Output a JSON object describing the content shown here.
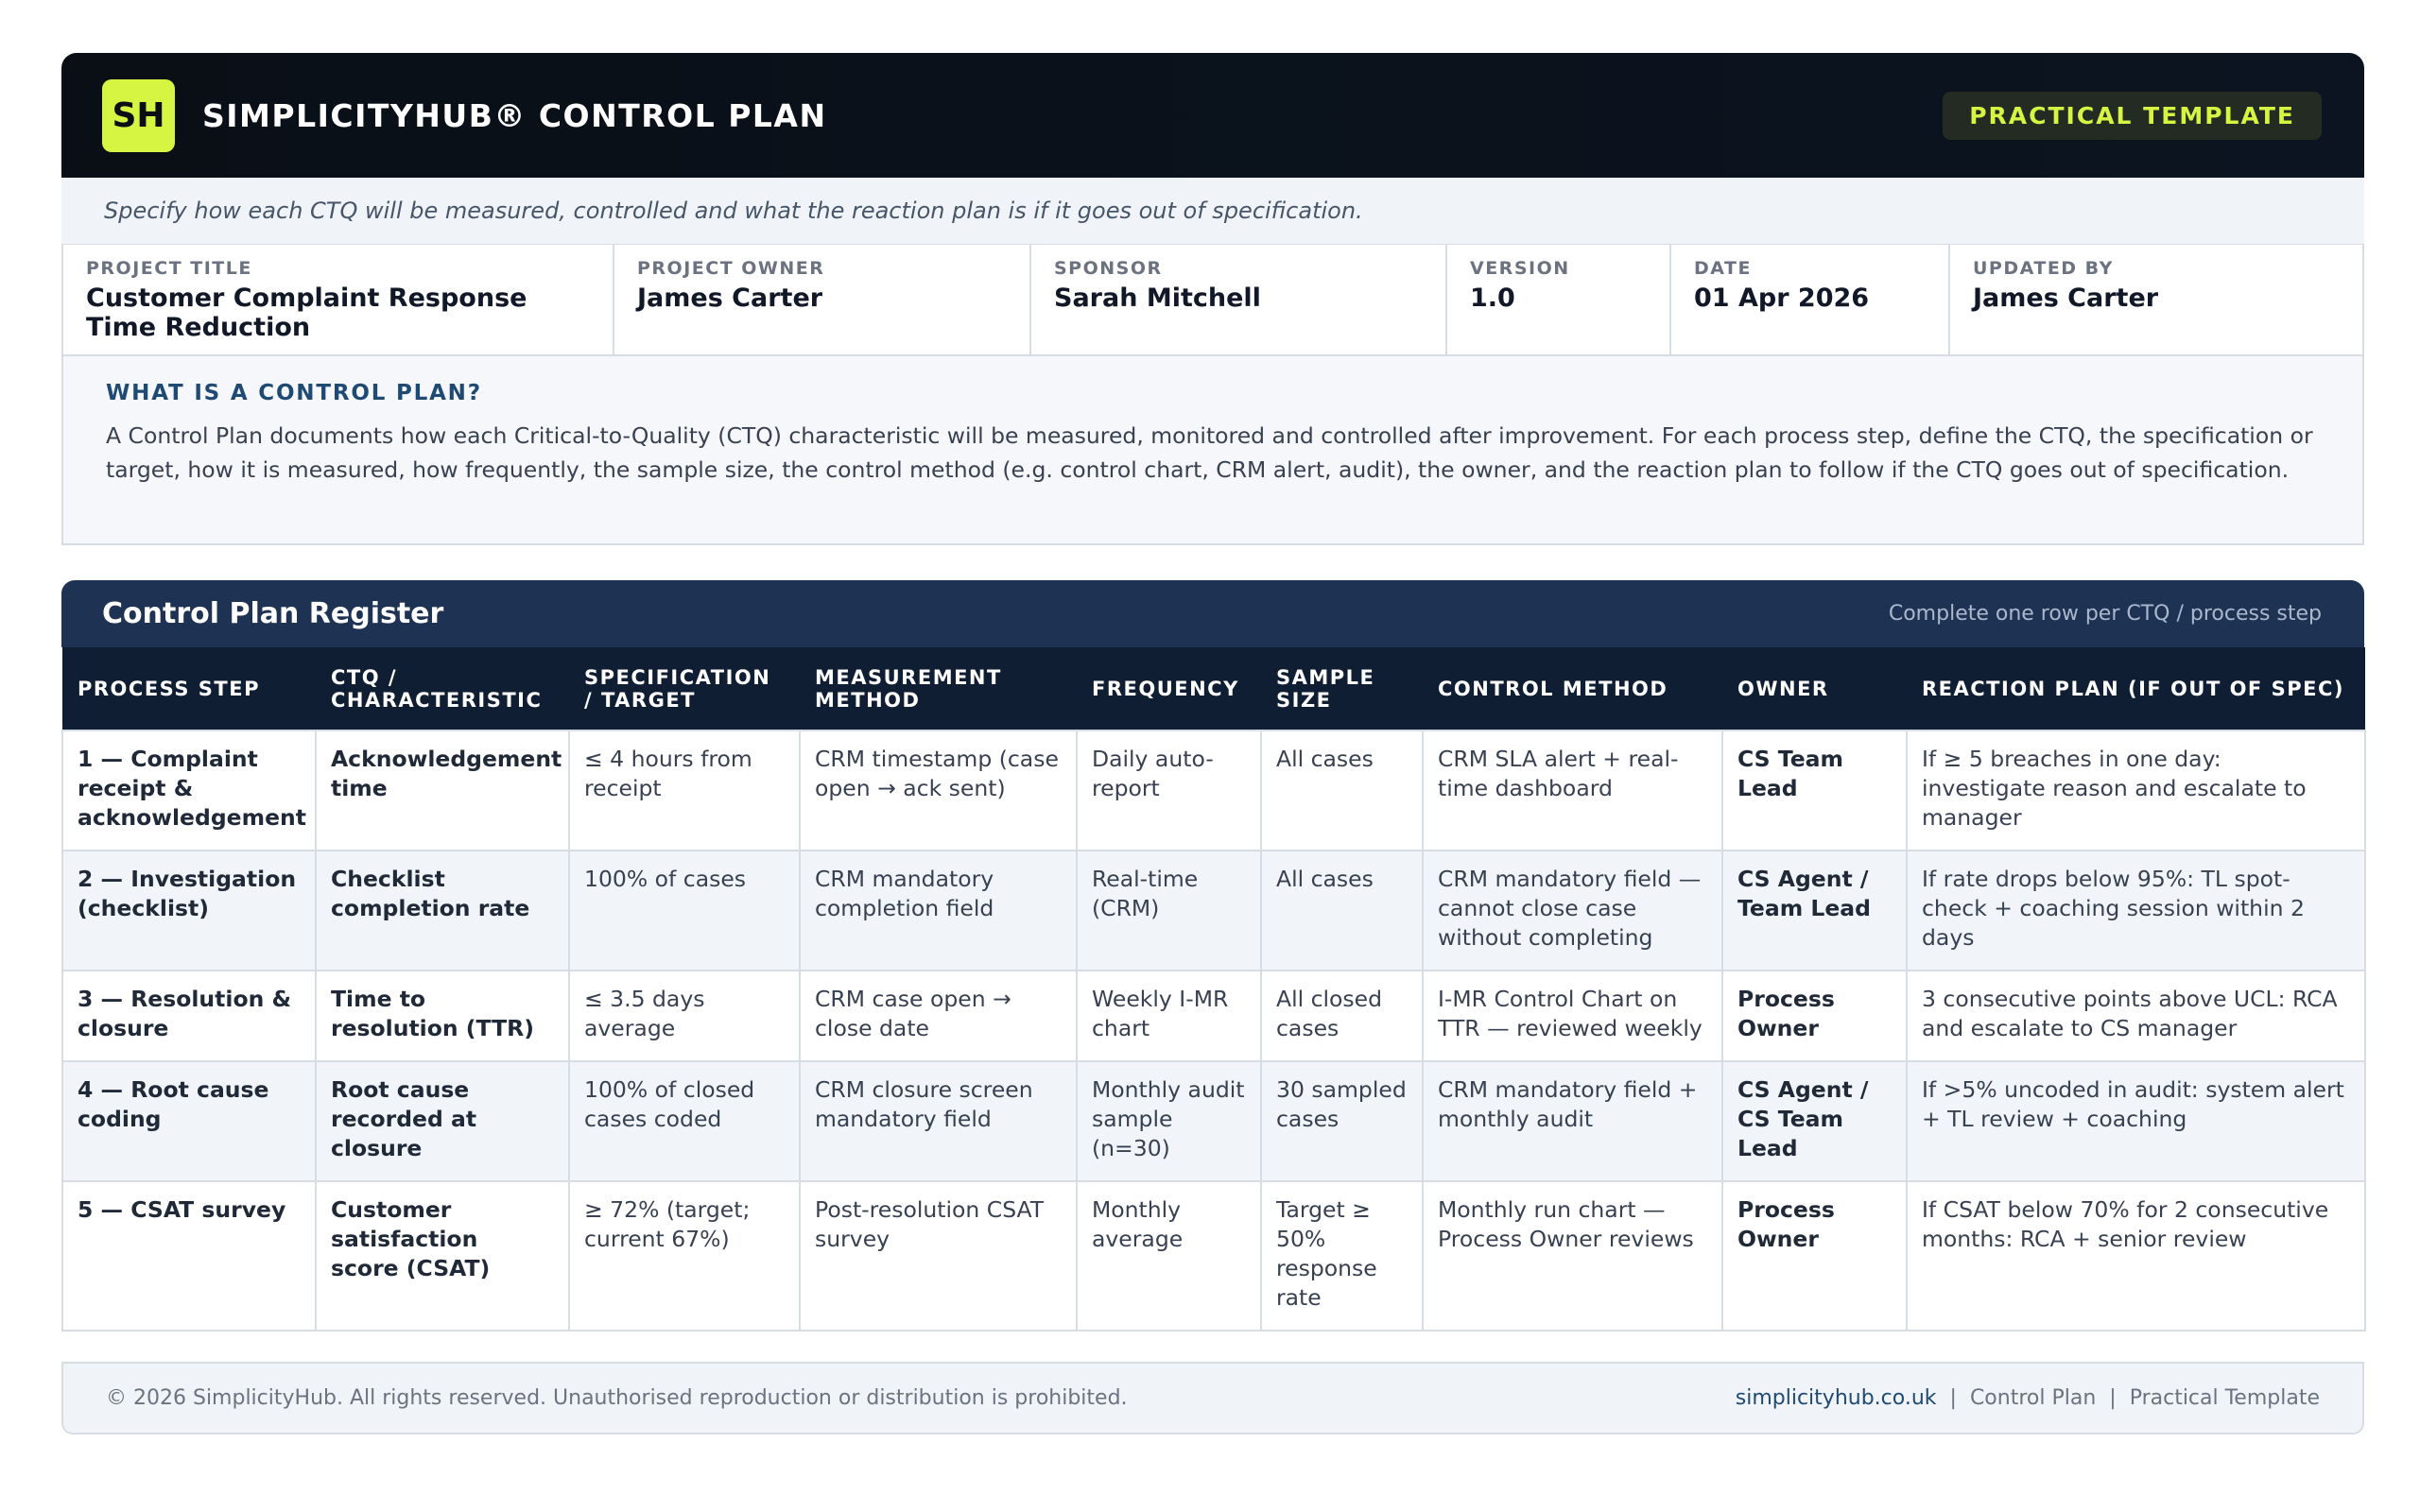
{
  "header": {
    "logo": "SH",
    "title": "SIMPLICITYHUB® CONTROL PLAN",
    "badge": "PRACTICAL TEMPLATE"
  },
  "intro": "Specify how each CTQ will be measured, controlled and what the reaction plan is if it goes out of specification.",
  "meta": [
    {
      "label": "PROJECT TITLE",
      "value": "Customer Complaint Response Time Reduction"
    },
    {
      "label": "PROJECT OWNER",
      "value": "James Carter"
    },
    {
      "label": "SPONSOR",
      "value": "Sarah Mitchell"
    },
    {
      "label": "VERSION",
      "value": "1.0"
    },
    {
      "label": "DATE",
      "value": "01 Apr 2026"
    },
    {
      "label": "UPDATED BY",
      "value": "James Carter"
    }
  ],
  "whatis": {
    "title": "WHAT IS A CONTROL PLAN?",
    "body": "A Control Plan documents how each Critical-to-Quality (CTQ) characteristic will be measured, monitored and controlled after improvement. For each process step, define the CTQ, the specification or target, how it is measured, how frequently, the sample size, the control method (e.g. control chart, CRM alert, audit), the owner, and the reaction plan to follow if the CTQ goes out of specification."
  },
  "register": {
    "title": "Control Plan Register",
    "hint": "Complete one row per CTQ / process step",
    "columns": [
      "PROCESS STEP",
      "CTQ / CHARACTERISTIC",
      "SPECIFICATION / TARGET",
      "MEASUREMENT METHOD",
      "FREQUENCY",
      "SAMPLE SIZE",
      "CONTROL METHOD",
      "OWNER",
      "REACTION PLAN (IF OUT OF SPEC)"
    ],
    "rows": [
      [
        "1 — Complaint receipt & acknowledgement",
        "Acknowledgement time",
        "≤ 4 hours from receipt",
        "CRM timestamp (case open → ack sent)",
        "Daily auto-report",
        "All cases",
        "CRM SLA alert + real-time dashboard",
        "CS Team Lead",
        "If ≥ 5 breaches in one day: investigate reason and escalate to manager"
      ],
      [
        "2 — Investigation (checklist)",
        "Checklist completion rate",
        "100% of cases",
        "CRM mandatory completion field",
        "Real-time (CRM)",
        "All cases",
        "CRM mandatory field — cannot close case without completing",
        "CS Agent / Team Lead",
        "If rate drops below 95%: TL spot-check + coaching session within 2 days"
      ],
      [
        "3 — Resolution & closure",
        "Time to resolution (TTR)",
        "≤ 3.5 days average",
        "CRM case open → close date",
        "Weekly I-MR chart",
        "All closed cases",
        "I-MR Control Chart on TTR — reviewed weekly",
        "Process Owner",
        "3 consecutive points above UCL: RCA and escalate to CS manager"
      ],
      [
        "4 — Root cause coding",
        "Root cause recorded at closure",
        "100% of closed cases coded",
        "CRM closure screen mandatory field",
        "Monthly audit sample (n=30)",
        "30 sampled cases",
        "CRM mandatory field + monthly audit",
        "CS Agent / CS Team Lead",
        "If >5% uncoded in audit: system alert + TL review + coaching"
      ],
      [
        "5 — CSAT survey",
        "Customer satisfaction score (CSAT)",
        "≥ 72% (target; current 67%)",
        "Post-resolution CSAT survey",
        "Monthly average",
        "Target ≥ 50% response rate",
        "Monthly run chart — Process Owner reviews",
        "Process Owner",
        "If CSAT below 70% for 2 consecutive months: RCA + senior review"
      ]
    ]
  },
  "footer": {
    "copyright": "© 2026 SimplicityHub. All rights reserved. Unauthorised reproduction or distribution is prohibited.",
    "link": "simplicityhub.co.uk",
    "sep": "|",
    "crumb1": "Control Plan",
    "crumb2": "Practical Template"
  },
  "colors": {
    "header_bg": "#0a0f16",
    "accent_lime": "#d6f542",
    "register_header": "#1e3354",
    "table_header": "#0f1e33",
    "link_blue": "#1e4a73"
  }
}
